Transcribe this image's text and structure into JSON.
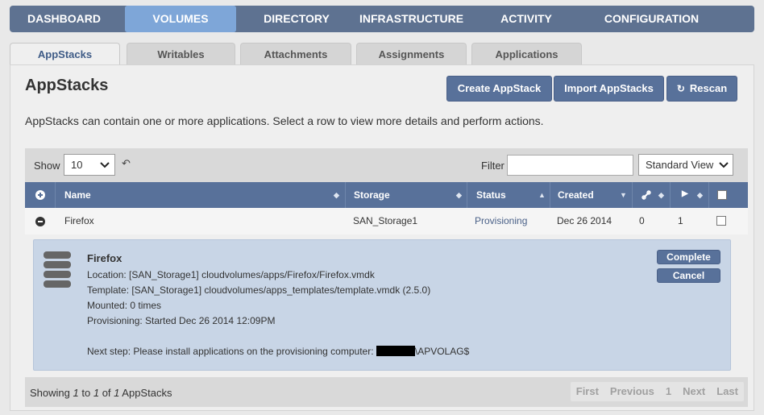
{
  "topnav": {
    "items": [
      {
        "label": "DASHBOARD",
        "active": false
      },
      {
        "label": "VOLUMES",
        "active": true
      },
      {
        "label": "DIRECTORY",
        "active": false
      },
      {
        "label": "INFRASTRUCTURE",
        "active": false
      },
      {
        "label": "ACTIVITY",
        "active": false
      },
      {
        "label": "CONFIGURATION",
        "active": false
      }
    ]
  },
  "subtabs": [
    "AppStacks",
    "Writables",
    "Attachments",
    "Assignments",
    "Applications"
  ],
  "page": {
    "title": "AppStacks",
    "description": "AppStacks can contain one or more applications. Select a row to view more details and perform actions.",
    "buttons": {
      "create": "Create AppStack",
      "import": "Import AppStacks",
      "rescan": "Rescan"
    }
  },
  "toolbar": {
    "show_label": "Show",
    "show_value": "10",
    "filter_label": "Filter",
    "filter_value": "",
    "view_value": "Standard View"
  },
  "table": {
    "headers": {
      "name": "Name",
      "storage": "Storage",
      "status": "Status",
      "created": "Created"
    },
    "row": {
      "name": "Firefox",
      "storage": "SAN_Storage1",
      "status": "Provisioning",
      "created": "Dec 26 2014",
      "attachments": "0",
      "applications": "1"
    }
  },
  "detail": {
    "title": "Firefox",
    "location": "Location: [SAN_Storage1] cloudvolumes/apps/Firefox/Firefox.vmdk",
    "template": "Template: [SAN_Storage1] cloudvolumes/apps_templates/template.vmdk (2.5.0)",
    "mounted": "Mounted: 0 times",
    "provisioning": "Provisioning: Started Dec 26 2014 12:09PM",
    "next_step_prefix": "Next step: Please install applications on the provisioning computer: ",
    "next_step_suffix": "\\APVOLAG$",
    "complete": "Complete",
    "cancel": "Cancel"
  },
  "footer": {
    "showing": "Showing",
    "start": "1",
    "to": "to",
    "end": "1",
    "of": "of",
    "total": "1",
    "unit": "AppStacks",
    "pager": {
      "first": "First",
      "previous": "Previous",
      "page": "1",
      "next": "Next",
      "last": "Last"
    }
  }
}
